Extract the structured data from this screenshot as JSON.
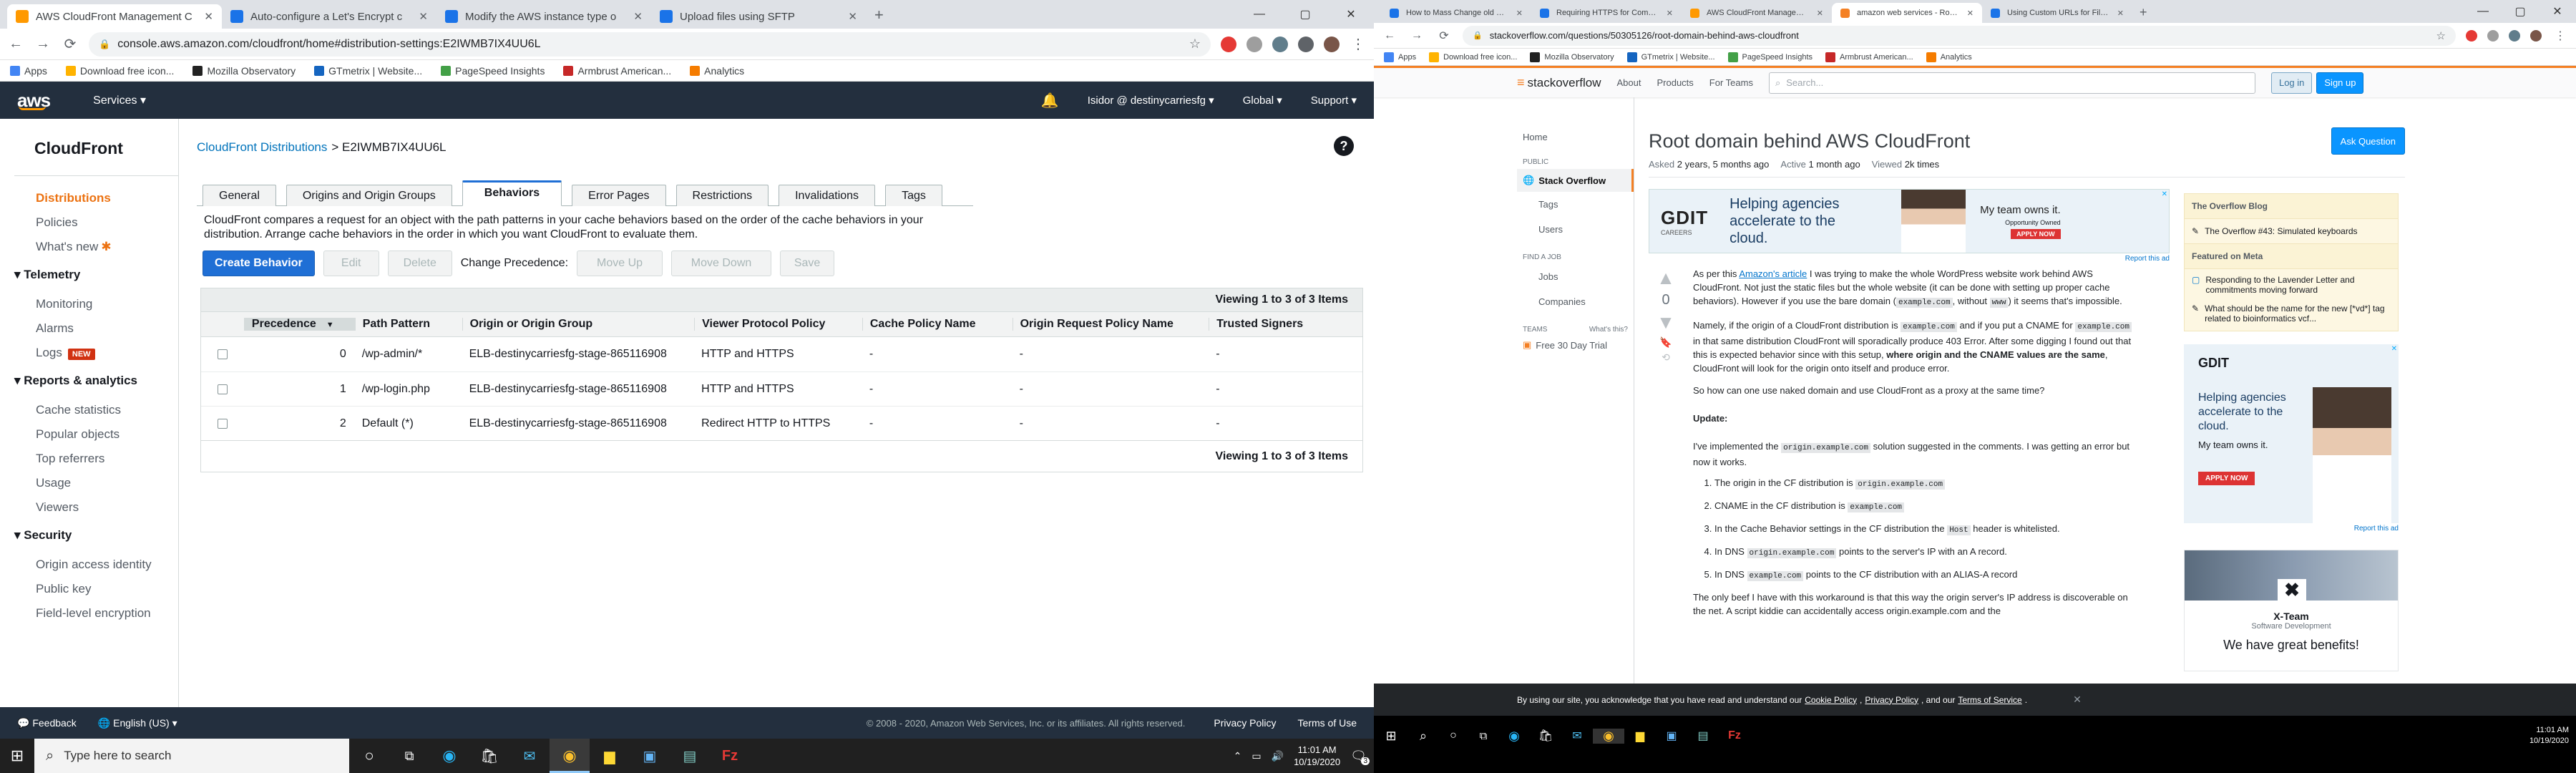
{
  "left_browser": {
    "tabs": [
      {
        "title": "AWS CloudFront Management C",
        "active": true,
        "color": "#ff9900"
      },
      {
        "title": "Auto-configure a Let's Encrypt c",
        "active": false,
        "color": "#1a73e8"
      },
      {
        "title": "Modify the AWS instance type o",
        "active": false,
        "color": "#1a73e8"
      },
      {
        "title": "Upload files using SFTP",
        "active": false,
        "color": "#1a73e8"
      }
    ],
    "url": "console.aws.amazon.com/cloudfront/home#distribution-settings:E2IWMB7IX4UU6L",
    "bookmarks": [
      "Apps",
      "Download free icon...",
      "Mozilla Observatory",
      "GTmetrix | Website...",
      "PageSpeed Insights",
      "Armbrust American...",
      "Analytics"
    ]
  },
  "aws": {
    "logo": "aws",
    "services": "Services",
    "user": "Isidor @ destinycarriesfg",
    "region": "Global",
    "support": "Support",
    "sidebar_title": "CloudFront",
    "nav1": [
      "Distributions",
      "Policies",
      "What's new"
    ],
    "telemetry_title": "Telemetry",
    "telemetry": [
      "Monitoring",
      "Alarms",
      "Logs"
    ],
    "new_badge": "NEW",
    "reports_title": "Reports & analytics",
    "reports": [
      "Cache statistics",
      "Popular objects",
      "Top referrers",
      "Usage",
      "Viewers"
    ],
    "security_title": "Security",
    "security": [
      "Origin access identity",
      "Public key",
      "Field-level encryption"
    ],
    "breadcrumb_link": "CloudFront Distributions",
    "breadcrumb_id": "> E2IWMB7IX4UU6L",
    "tabs": [
      "General",
      "Origins and Origin Groups",
      "Behaviors",
      "Error Pages",
      "Restrictions",
      "Invalidations",
      "Tags"
    ],
    "active_tab": "Behaviors",
    "description": "CloudFront compares a request for an object with the path patterns in your cache behaviors based on the order of the cache behaviors in your distribution. Arrange cache behaviors in the order in which you want CloudFront to evaluate them.",
    "create_behavior": "Create Behavior",
    "edit": "Edit",
    "delete": "Delete",
    "change_precedence": "Change Precedence:",
    "move_up": "Move Up",
    "move_down": "Move Down",
    "save": "Save",
    "viewing": "Viewing 1 to 3 of 3 Items",
    "columns": [
      "Precedence",
      "Path Pattern",
      "Origin or Origin Group",
      "Viewer Protocol Policy",
      "Cache Policy Name",
      "Origin Request Policy Name",
      "Trusted Signers"
    ],
    "rows": [
      {
        "precedence": "0",
        "path": "/wp-admin/*",
        "origin": "ELB-destinycarriesfg-stage-865116908",
        "protocol": "HTTP and HTTPS",
        "cache": "-",
        "request": "-",
        "signers": "-"
      },
      {
        "precedence": "1",
        "path": "/wp-login.php",
        "origin": "ELB-destinycarriesfg-stage-865116908",
        "protocol": "HTTP and HTTPS",
        "cache": "-",
        "request": "-",
        "signers": "-"
      },
      {
        "precedence": "2",
        "path": "Default (*)",
        "origin": "ELB-destinycarriesfg-stage-865116908",
        "protocol": "Redirect HTTP to HTTPS",
        "cache": "-",
        "request": "-",
        "signers": "-"
      }
    ],
    "footer_feedback": "Feedback",
    "footer_lang": "English (US)",
    "footer_copy": "© 2008 - 2020, Amazon Web Services, Inc. or its affiliates. All rights reserved.",
    "footer_privacy": "Privacy Policy",
    "footer_terms": "Terms of Use"
  },
  "taskbar_left": {
    "search_placeholder": "Type here to search",
    "time": "11:01 AM",
    "date": "10/19/2020",
    "notif": "3"
  },
  "right_browser": {
    "tabs": [
      {
        "title": "How to Mass Change old URLs",
        "active": false
      },
      {
        "title": "Requiring HTTPS for Communic",
        "active": false
      },
      {
        "title": "AWS CloudFront Management C",
        "active": false
      },
      {
        "title": "amazon web services - Root do",
        "active": true
      },
      {
        "title": "Using Custom URLs for Files b",
        "active": false
      }
    ],
    "url": "stackoverflow.com/questions/50305126/root-domain-behind-aws-cloudfront",
    "bookmarks": [
      "Apps",
      "Download free icon...",
      "Mozilla Observatory",
      "GTmetrix | Website...",
      "PageSpeed Insights",
      "Armbrust American...",
      "Analytics"
    ]
  },
  "so": {
    "logo": "stackoverflow",
    "nav": [
      "About",
      "Products",
      "For Teams"
    ],
    "search_placeholder": "Search...",
    "login": "Log in",
    "signup": "Sign up",
    "side_home": "Home",
    "side_public": "PUBLIC",
    "side_so": "Stack Overflow",
    "side_tags": "Tags",
    "side_users": "Users",
    "side_findjob": "FIND A JOB",
    "side_jobs": "Jobs",
    "side_companies": "Companies",
    "side_teams": "TEAMS",
    "side_whats": "What's this?",
    "side_trial": "Free 30 Day Trial",
    "title": "Root domain behind AWS CloudFront",
    "ask": "Ask Question",
    "asked_label": "Asked",
    "asked": "2 years, 5 months ago",
    "active_label": "Active",
    "active": "1 month ago",
    "viewed_label": "Viewed",
    "viewed": "2k times",
    "ad_brand": "GDIT",
    "ad_sub": "CAREERS",
    "ad_text": "Helping agencies accelerate to the cloud.",
    "ad_team": "My team owns it.",
    "ad_opp": "Opportunity Owned",
    "ad_apply": "APPLY NOW",
    "report_ad": "Report this ad",
    "vote": "0",
    "p1a": "As per this",
    "p1link": "Amazon's article",
    "p1b": "I was trying to make the whole WordPress website work behind AWS CloudFront. Not just the static files but the whole website (it can be done with setting up proper cache behaviors). However if you use the bare domain (",
    "code_example": "example.com",
    "p1c": ", without",
    "code_www": "www",
    "p1d": ") it seems that's impossible.",
    "p2a": "Namely, if the origin of a CloudFront distribution is",
    "p2b": "and if you put a CNAME for",
    "p2c": "in that same distribution CloudFront will sporadically produce 403 Error. After some digging I found out that this is expected behavior since with this setup,",
    "p2bold": "where origin and the CNAME values are the same",
    "p2d": ", CloudFront will look for the origin onto itself and produce error.",
    "p3": "So how can one use naked domain and use CloudFront as a proxy at the same time?",
    "update": "Update:",
    "p4a": "I've implemented the",
    "code_origin": "origin.example.com",
    "p4b": "solution suggested in the comments. I was getting an error but now it works.",
    "list": [
      {
        "a": "The origin in the CF distribution is",
        "code": "origin.example.com",
        "b": ""
      },
      {
        "a": "CNAME in the CF distribution is",
        "code": "example.com",
        "b": ""
      },
      {
        "a": "In the Cache Behavior settings in the CF distribution the",
        "code": "Host",
        "b": "header is whitelisted."
      },
      {
        "a": "In DNS",
        "code": "origin.example.com",
        "b": "points to the server's IP with an A record."
      },
      {
        "a": "In DNS",
        "code": "example.com",
        "b": "points to the CF distribution with an ALIAS-A record"
      }
    ],
    "p5": "The only beef I have with this workaround is that this way the origin server's IP address is discoverable on the net. A script kiddie can accidentally access origin.example.com and the",
    "blog_title": "The Overflow Blog",
    "blog_item": "The Overflow #43: Simulated keyboards",
    "meta_title": "Featured on Meta",
    "meta1": "Responding to the Lavender Letter and commitments moving forward",
    "meta2": "What should be the name for the new [*vd*] tag related to bioinformatics vcf...",
    "side_ad_brand": "GDIT",
    "side_ad_text": "Helping agencies accelerate to the cloud.",
    "side_ad_team": "My team owns it.",
    "xteam": "X-Team",
    "xteam_sub": "Software Development",
    "xteam_benefits": "We have great benefits!",
    "cookie_a": "By using our site, you acknowledge that you have read and understand our",
    "cookie_cp": "Cookie Policy",
    "cookie_pp": "Privacy Policy",
    "cookie_and": ", and our",
    "cookie_tos": "Terms of Service"
  },
  "taskbar_right": {
    "time": "11:01 AM",
    "date": "10/19/2020"
  }
}
